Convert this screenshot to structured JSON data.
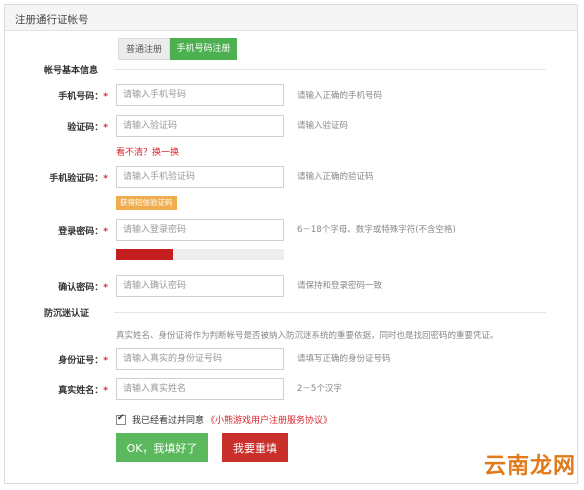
{
  "header": {
    "title": "注册通行证帐号"
  },
  "tabs": [
    {
      "label": "普通注册",
      "active": false
    },
    {
      "label": "手机号码注册",
      "active": true
    }
  ],
  "sections": {
    "basic": "帐号基本信息",
    "anti_addiction": "防沉迷认证"
  },
  "required_mark": "*",
  "fields": {
    "phone": {
      "label": "手机号码：",
      "placeholder": "请输入手机号码",
      "hint": "请输入正确的手机号码"
    },
    "captcha": {
      "label": "验证码：",
      "placeholder": "请输入验证码",
      "hint": "请输入验证码"
    },
    "sms_code": {
      "label": "手机验证码：",
      "placeholder": "请输入手机验证码",
      "hint": "请输入正确的验证码"
    },
    "password": {
      "label": "登录密码：",
      "placeholder": "请输入登录密码",
      "hint": "6－18个字母、数字或特殊字符(不含空格)"
    },
    "confirm_password": {
      "label": "确认密码：",
      "placeholder": "请输入确认密码",
      "hint": "请保持和登录密码一致"
    },
    "id_number": {
      "label": "身份证号：",
      "placeholder": "请输入真实的身份证号码",
      "hint": "请填写正确的身份证号码"
    },
    "real_name": {
      "label": "真实姓名：",
      "placeholder": "请输入真实姓名",
      "hint": "2－5个汉字"
    }
  },
  "captcha_refresh": "看不清？换一换",
  "sms_button": "获得短信验证码",
  "password_strength": {
    "fraction": 0.34,
    "color": "#c41e1e"
  },
  "anti_addiction_notice": "真实姓名、身份证将作为判断帐号是否被纳入防沉迷系统的重要依据，同时也是找回密码的重要凭证。",
  "agreement": {
    "checked": true,
    "check_mark": "✔",
    "text": "我已经看过并同意",
    "link": "《小熊游戏用户注册服务协议》"
  },
  "buttons": {
    "ok": "OK，我填好了",
    "reset": "我要重填"
  },
  "watermark": "云南龙网",
  "colors": {
    "green": "#5cb85c",
    "red": "#c9302c",
    "orange": "#f0ad4e"
  }
}
